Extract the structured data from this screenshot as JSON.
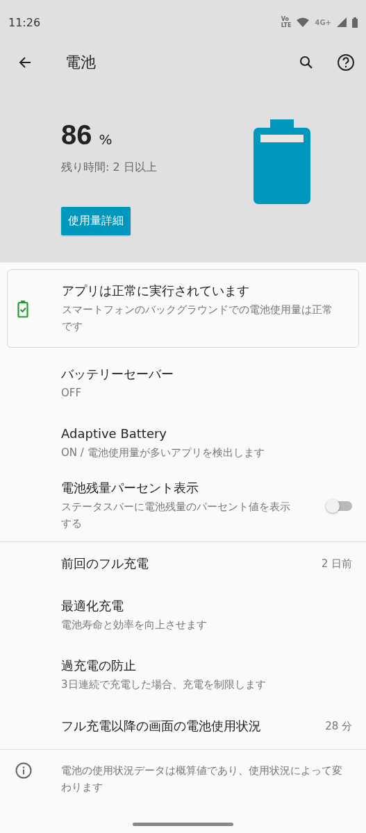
{
  "status_bar": {
    "time": "11:26",
    "volte_top": "Vo",
    "volte_bottom": "LTE",
    "network": "4G+"
  },
  "app_bar": {
    "title": "電池"
  },
  "header": {
    "percent": "86",
    "percent_unit": "%",
    "remaining": "残り時間: 2 日以上",
    "button": "使用量詳細"
  },
  "status_card": {
    "title": "アプリは正常に実行されています",
    "summary": "スマートフォンのバックグラウンドでの電池使用量は正常です"
  },
  "sections": [
    [
      {
        "kind": "setting",
        "title": "バッテリーセーバー",
        "summary": "OFF"
      },
      {
        "kind": "setting",
        "title": "Adaptive Battery",
        "summary": "ON / 電池使用量が多いアプリを検出します"
      },
      {
        "kind": "toggle",
        "title": "電池残量パーセント表示",
        "summary": "ステータスバーに電池残量のパーセント値を表示する",
        "on": false
      }
    ],
    [
      {
        "kind": "value",
        "title": "前回のフル充電",
        "value": "2 日前"
      },
      {
        "kind": "setting",
        "title": "最適化充電",
        "summary": "電池寿命と効率を向上させます"
      },
      {
        "kind": "setting",
        "title": "過充電の防止",
        "summary": "3日連続で充電した場合、充電を制限します"
      },
      {
        "kind": "value",
        "title": "フル充電以降の画面の電池使用状況",
        "value": "28 分"
      }
    ]
  ],
  "footer": {
    "text": "電池の使用状況データは概算値であり、使用状況によって変わります"
  }
}
